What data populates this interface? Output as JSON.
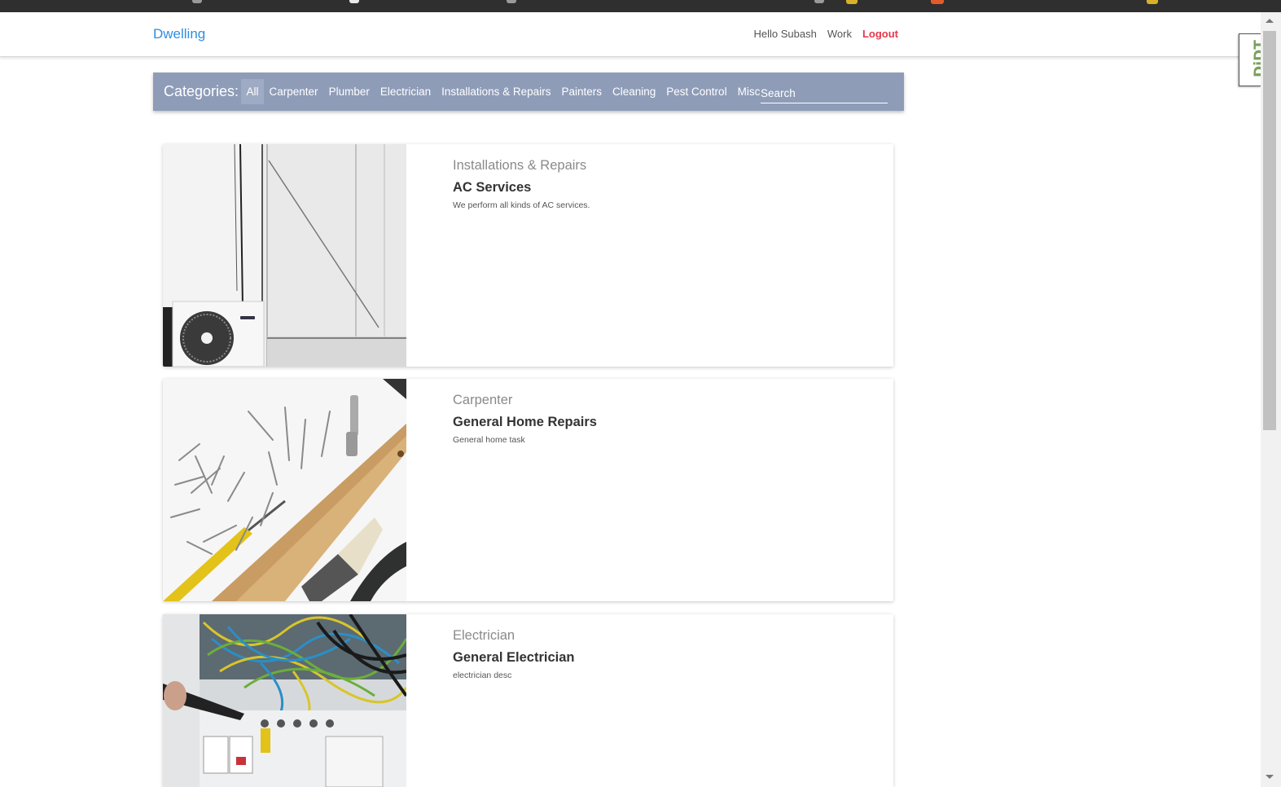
{
  "brand": "Dwelling",
  "nav": {
    "greeting": "Hello Subash",
    "work": "Work",
    "logout": "Logout"
  },
  "categories": {
    "title": "Categories:",
    "items": [
      "All",
      "Carpenter",
      "Plumber",
      "Electrician",
      "Installations & Repairs",
      "Painters",
      "Cleaning",
      "Pest Control",
      "Misc"
    ],
    "active": "All",
    "search_placeholder": "Search"
  },
  "services": [
    {
      "category": "Installations & Repairs",
      "title": "AC Services",
      "description": "We perform all kinds of AC services.",
      "image_icon": "ac-unit-photo"
    },
    {
      "category": "Carpenter",
      "title": "General Home Repairs",
      "description": "General home task",
      "image_icon": "tools-photo"
    },
    {
      "category": "Electrician",
      "title": "General Electrician",
      "description": "electrician desc",
      "image_icon": "electrical-panel-photo"
    }
  ],
  "devtool_tab": "DjDT",
  "colors": {
    "brand": "#2f8ee0",
    "logout": "#e8364c",
    "category_bar": "#8e9cb8"
  }
}
